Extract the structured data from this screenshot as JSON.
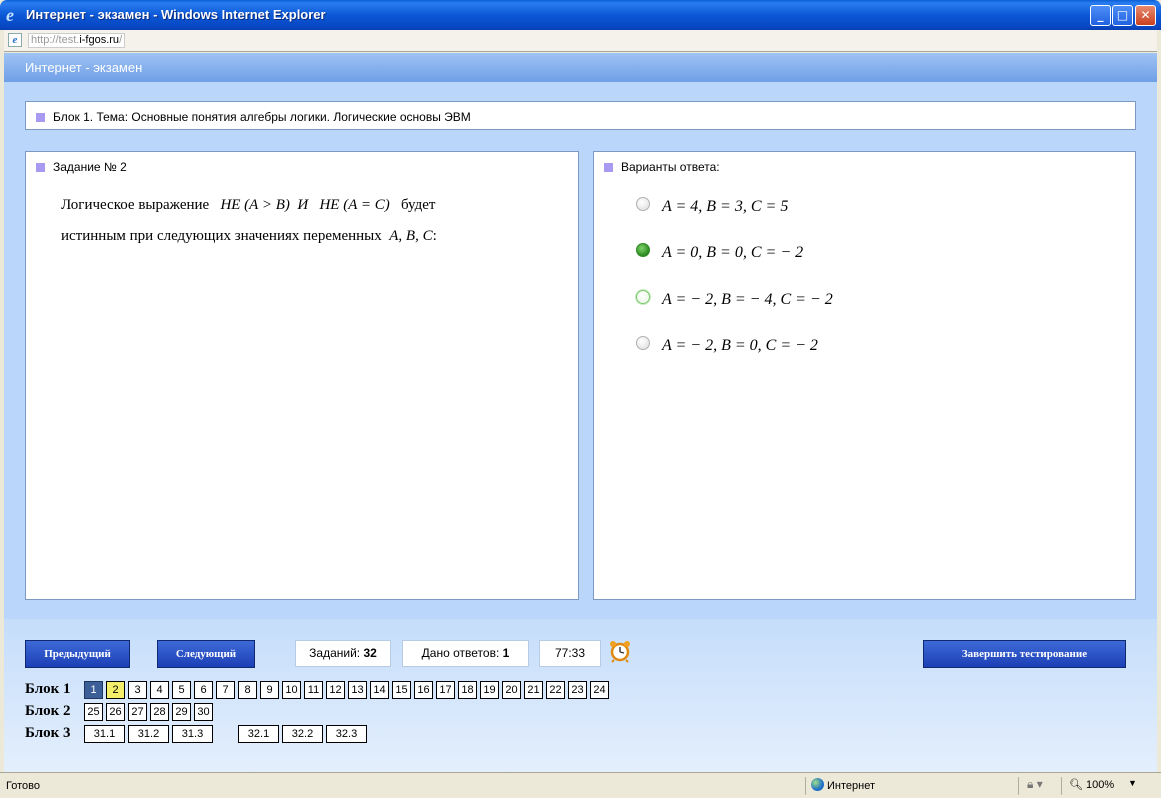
{
  "window": {
    "title": "Интернет - экзамен - Windows Internet Explorer",
    "min_label": "_",
    "max_label": "□",
    "close_label": "✕"
  },
  "address": {
    "url_prefix": "http://test.",
    "url_domain": "i-fgos.ru",
    "url_suffix": "/"
  },
  "page": {
    "header": "Интернет - экзамен",
    "block_topic": "Блок 1. Тема: Основные понятия алгебры логики. Логические основы ЭВМ"
  },
  "task": {
    "heading": "Задание № 2",
    "text_1": "Логическое выражение",
    "expr_1": "НЕ (A > B)",
    "and_word": "И",
    "expr_2": "НЕ (A = C)",
    "text_2": "будет",
    "text_3": "истинным при следующих значениях переменных",
    "vars": "A, B, C",
    "colon": ":"
  },
  "answers": {
    "heading": "Варианты ответа:",
    "options": [
      {
        "text": "A = 4, B = 3, C = 5",
        "state": "normal"
      },
      {
        "text": "A = 0, B = 0, C = − 2",
        "state": "selected"
      },
      {
        "text": "A = − 2, B = − 4, C = − 2",
        "state": "hover"
      },
      {
        "text": "A = − 2, B = 0, C = − 2",
        "state": "normal"
      }
    ]
  },
  "controls": {
    "prev_label": "Предыдущий",
    "next_label": "Следующий",
    "finish_label": "Завершить тестирование",
    "tasks_label": "Заданий:",
    "tasks_count": "32",
    "answered_label": "Дано ответов:",
    "answered_count": "1",
    "timer": "77:33",
    "timer_icon": "alarm-clock-icon"
  },
  "blocks": [
    {
      "label": "Блок 1",
      "items": [
        "1",
        "2",
        "3",
        "4",
        "5",
        "6",
        "7",
        "8",
        "9",
        "10",
        "11",
        "12",
        "13",
        "14",
        "15",
        "16",
        "17",
        "18",
        "19",
        "20",
        "21",
        "22",
        "23",
        "24"
      ]
    },
    {
      "label": "Блок 2",
      "items": [
        "25",
        "26",
        "27",
        "28",
        "29",
        "30"
      ]
    },
    {
      "label": "Блок 3",
      "items": [
        "31.1",
        "31.2",
        "31.3",
        "32.1",
        "32.2",
        "32.3"
      ]
    }
  ],
  "status": {
    "text": "Готово",
    "zone": "Интернет",
    "zoom": "100%"
  },
  "colors": {
    "current_question": "#3c5f97",
    "answered_question": "#f4ef6a",
    "selected_radio": "#2b8a1f",
    "button_blue": "#1c3fb5"
  }
}
